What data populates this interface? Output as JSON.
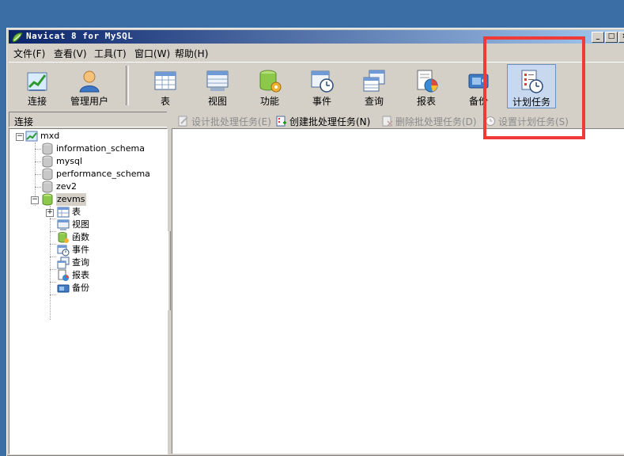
{
  "window": {
    "title": "Navicat 8 for MySQL"
  },
  "menu": [
    "文件(F)",
    "查看(V)",
    "工具(T)",
    "窗口(W)",
    "帮助(H)"
  ],
  "toolbar": [
    {
      "label": "连接"
    },
    {
      "label": "管理用户"
    },
    {
      "label": "表"
    },
    {
      "label": "视图"
    },
    {
      "label": "功能"
    },
    {
      "label": "事件"
    },
    {
      "label": "查询"
    },
    {
      "label": "报表"
    },
    {
      "label": "备份"
    },
    {
      "label": "计划任务",
      "active": true
    }
  ],
  "left_panel": {
    "header": "连接"
  },
  "actions": [
    {
      "label": "设计批处理任务(E)",
      "enabled": false
    },
    {
      "label": "创建批处理任务(N)",
      "enabled": true
    },
    {
      "label": "删除批处理任务(D)",
      "enabled": false
    },
    {
      "label": "设置计划任务(S)",
      "enabled": false
    }
  ],
  "tree": {
    "connection": "mxd",
    "databases": [
      "information_schema",
      "mysql",
      "performance_schema",
      "zev2",
      "zevms"
    ],
    "selected_database": "zevms",
    "objects": [
      "表",
      "视图",
      "函数",
      "事件",
      "查询",
      "报表",
      "备份"
    ]
  },
  "colors": {
    "highlight": "#f03a3a",
    "titlebar": "#0a246a",
    "desktop": "#3a6ea5"
  }
}
